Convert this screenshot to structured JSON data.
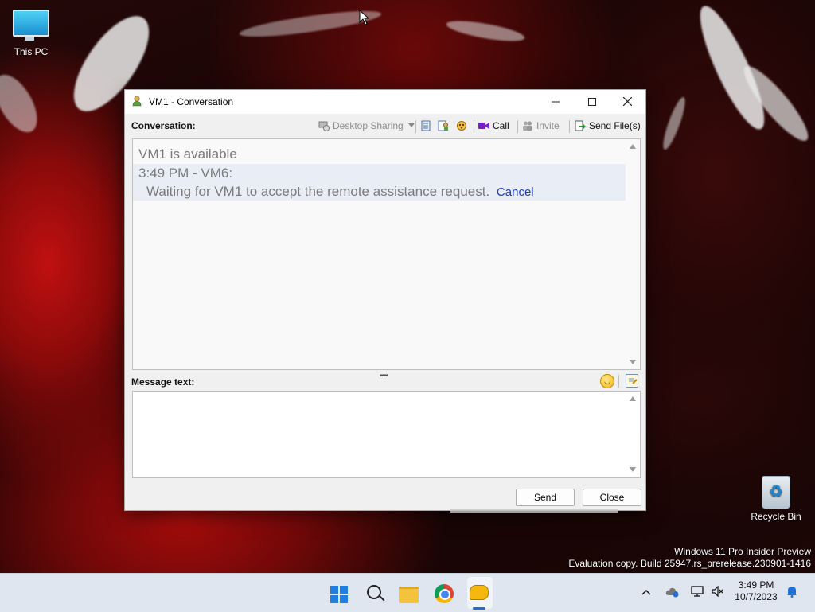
{
  "desktop": {
    "icons": [
      {
        "label": "This PC"
      },
      {
        "label": "Recycle Bin"
      }
    ],
    "watermark": {
      "line1": "Windows 11 Pro Insider Preview",
      "line2": "Evaluation copy. Build 25947.rs_prerelease.230901-1416"
    }
  },
  "window": {
    "title": "VM1 - Conversation",
    "conversation_label": "Conversation:",
    "toolbar": {
      "desktop_sharing": "Desktop Sharing",
      "call": "Call",
      "invite": "Invite",
      "send_files": "Send File(s)"
    },
    "messages": {
      "status": "VM1 is available",
      "header": "3:49 PM - VM6:",
      "body": "Waiting for VM1 to accept the remote assistance request.",
      "cancel_link": "Cancel"
    },
    "message_label": "Message text:",
    "message_value": "",
    "buttons": {
      "send": "Send",
      "close": "Close"
    }
  },
  "taskbar": {
    "time": "3:49 PM",
    "date": "10/7/2023"
  },
  "colors": {
    "accent": "#1f7fe0",
    "link": "#1a3fb3",
    "taskbar": "#dfe6ef"
  }
}
